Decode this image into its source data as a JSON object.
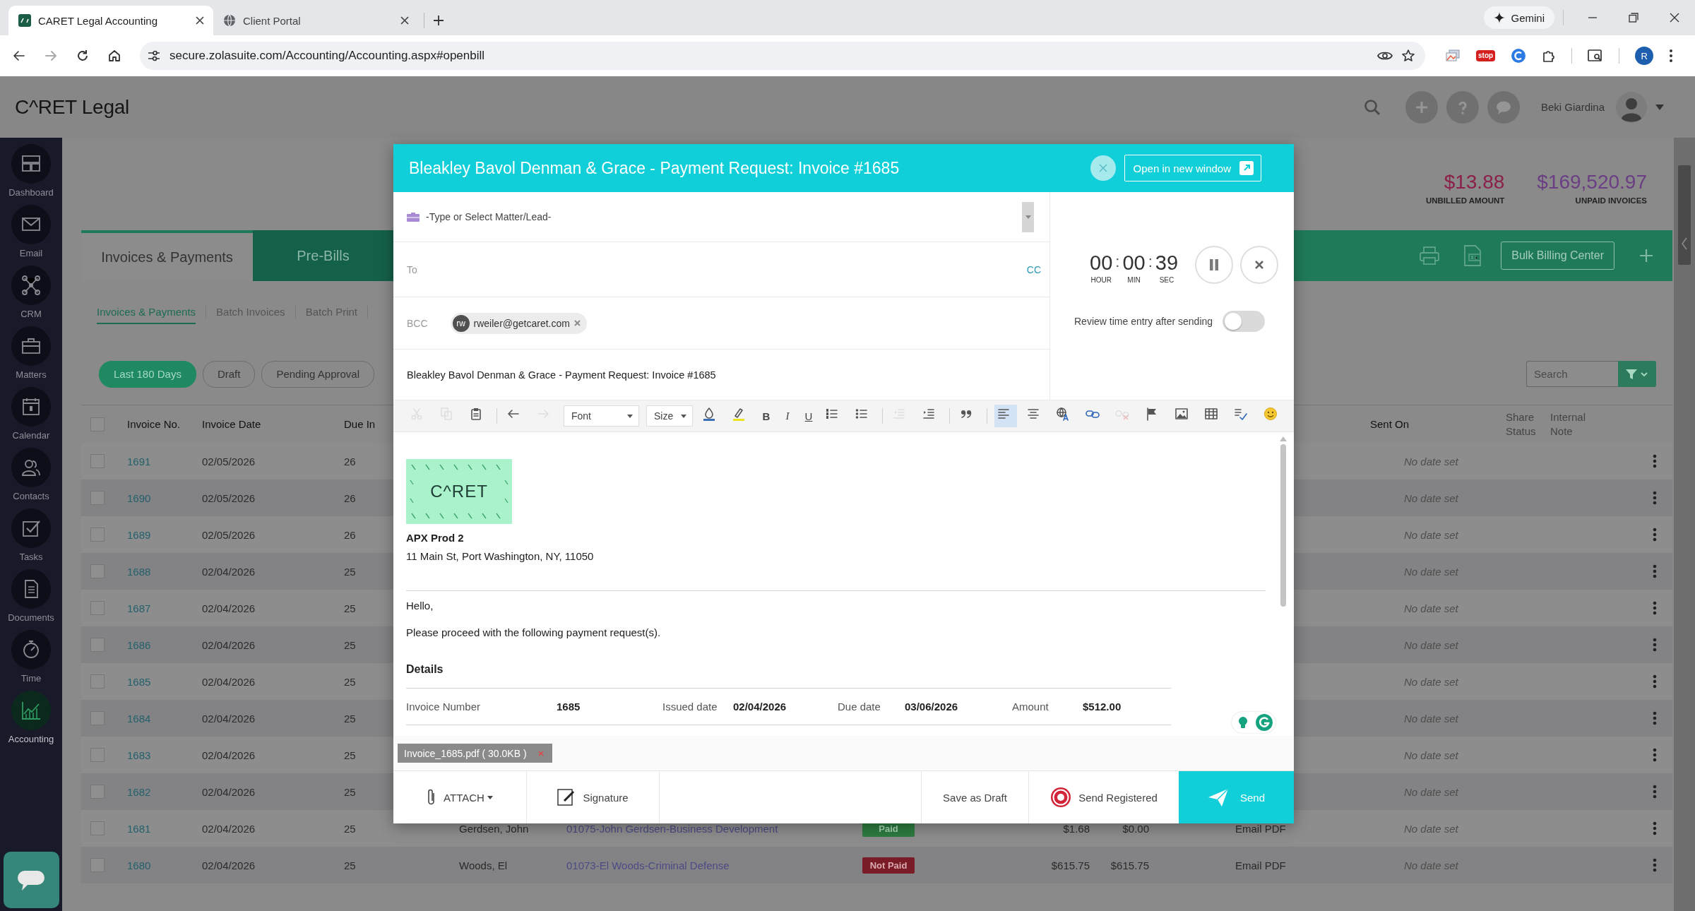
{
  "browser": {
    "tabs": [
      {
        "title": "CARET Legal Accounting",
        "selected": true
      },
      {
        "title": "Client Portal",
        "selected": false
      }
    ],
    "address": "secure.zolasuite.com/Accounting/Accounting.aspx#openbill",
    "gemini": "Gemini",
    "extension_label": "stop",
    "profile": "R"
  },
  "header": {
    "logo": "C^RET Legal",
    "user": "Beki Giardina"
  },
  "sidebar": {
    "items": [
      {
        "label": "Dashboard",
        "selected": false
      },
      {
        "label": "Email",
        "selected": false
      },
      {
        "label": "CRM",
        "selected": false
      },
      {
        "label": "Matters",
        "selected": false
      },
      {
        "label": "Calendar",
        "selected": false
      },
      {
        "label": "Contacts",
        "selected": false
      },
      {
        "label": "Tasks",
        "selected": false
      },
      {
        "label": "Documents",
        "selected": false
      },
      {
        "label": "Time",
        "selected": false
      },
      {
        "label": "Accounting",
        "selected": true
      }
    ]
  },
  "summary": [
    {
      "amount": "$13.88",
      "label": "UNBILLED AMOUNT",
      "color": "#8c1e4a"
    },
    {
      "amount": "$169,520.97",
      "label": "UNPAID INVOICES",
      "color": "#6b3d84"
    }
  ],
  "main_tabs": [
    {
      "label": "Invoices & Payments",
      "selected": true
    },
    {
      "label": "Pre-Bills",
      "selected": false
    }
  ],
  "bulk_button": "Bulk Billing Center",
  "sub_tabs": [
    {
      "label": "Invoices & Payments",
      "selected": true
    },
    {
      "label": "Batch Invoices",
      "selected": false
    },
    {
      "label": "Batch Print",
      "selected": false
    }
  ],
  "filters": [
    {
      "label": "Last 180 Days",
      "selected": true
    },
    {
      "label": "Draft",
      "selected": false
    },
    {
      "label": "Pending Approval",
      "selected": false
    }
  ],
  "search": {
    "placeholder": "Search"
  },
  "table": {
    "select_all": {
      "checked": false
    },
    "columns": [
      "Invoice No.",
      "Invoice Date",
      "Due In",
      "Sent On",
      "Share Status",
      "Internal Note"
    ],
    "rows": [
      {
        "checked": false,
        "invoice": "1691",
        "date": "02/05/2026",
        "due_in": "26",
        "sent_on": "No date set"
      },
      {
        "checked": false,
        "invoice": "1690",
        "date": "02/05/2026",
        "due_in": "26",
        "sent_on": "No date set"
      },
      {
        "checked": false,
        "invoice": "1689",
        "date": "02/05/2026",
        "due_in": "26",
        "sent_on": "No date set"
      },
      {
        "checked": false,
        "invoice": "1688",
        "date": "02/04/2026",
        "due_in": "25",
        "sent_on": "No date set"
      },
      {
        "checked": false,
        "invoice": "1687",
        "date": "02/04/2026",
        "due_in": "25",
        "sent_on": "No date set"
      },
      {
        "checked": false,
        "invoice": "1686",
        "date": "02/04/2026",
        "due_in": "25",
        "sent_on": "No date set"
      },
      {
        "checked": false,
        "invoice": "1685",
        "date": "02/04/2026",
        "due_in": "25",
        "sent_on": "No date set"
      },
      {
        "checked": false,
        "invoice": "1684",
        "date": "02/04/2026",
        "due_in": "25",
        "sent_on": "No date set"
      },
      {
        "checked": false,
        "invoice": "1683",
        "date": "02/04/2026",
        "due_in": "25",
        "sent_on": "No date set"
      },
      {
        "checked": false,
        "invoice": "1682",
        "date": "02/04/2026",
        "due_in": "25",
        "sent_on": "No date set"
      },
      {
        "checked": false,
        "invoice": "1681",
        "date": "02/04/2026",
        "due_in": "25",
        "client": "Gerdsen, John",
        "matter": "01075-John Gerdsen-Business Development",
        "status": {
          "label": "Paid",
          "kind": "paid"
        },
        "total": "$1.68",
        "balance": "$0.00",
        "sent_via": "Email PDF",
        "sent_on": "No date set"
      },
      {
        "checked": false,
        "invoice": "1680",
        "date": "02/04/2026",
        "due_in": "25",
        "client": "Woods, El",
        "matter": "01073-El Woods-Criminal Defense",
        "status": {
          "label": "Not Paid",
          "kind": "not_paid"
        },
        "total": "$615.75",
        "balance": "$615.75",
        "sent_via": "Email PDF",
        "sent_on": "No date set"
      }
    ]
  },
  "modal": {
    "title": "Bleakley Bavol Denman & Grace - Payment Request: Invoice #1685",
    "open_new": "Open in new window",
    "matter_placeholder": "-Type or Select Matter/Lead-",
    "to_label": "To",
    "cc": "CC",
    "bcc_label": "BCC",
    "bcc_chips": [
      {
        "initials": "rw",
        "email": "rweiler@getcaret.com"
      }
    ],
    "subject": "Bleakley Bavol Denman & Grace - Payment Request: Invoice #1685",
    "timer": {
      "units": [
        {
          "value": "00",
          "label": "HOUR"
        },
        {
          "value": "00",
          "label": "MIN"
        },
        {
          "value": "39",
          "label": "SEC"
        }
      ],
      "separator": ":"
    },
    "review_toggle": {
      "label": "Review time entry after sending",
      "on": false
    },
    "toolbar": [
      {
        "kind": "cut",
        "disabled": true
      },
      {
        "kind": "copy",
        "disabled": true
      },
      {
        "kind": "paste",
        "disabled": false
      },
      {
        "kind": "separator"
      },
      {
        "kind": "undo",
        "disabled": false
      },
      {
        "kind": "redo",
        "disabled": true
      },
      {
        "kind": "dropdown",
        "label": "Font"
      },
      {
        "kind": "dropdown",
        "label": "Size"
      },
      {
        "kind": "text_color",
        "disabled": false
      },
      {
        "kind": "highlight",
        "disabled": false
      },
      {
        "kind": "bold",
        "label": "B",
        "disabled": false
      },
      {
        "kind": "italic",
        "label": "I",
        "disabled": false
      },
      {
        "kind": "underline",
        "label": "U",
        "disabled": false
      },
      {
        "kind": "numbered_list",
        "disabled": false
      },
      {
        "kind": "bullet_list",
        "disabled": false
      },
      {
        "kind": "separator"
      },
      {
        "kind": "outdent",
        "disabled": true
      },
      {
        "kind": "indent",
        "disabled": false
      },
      {
        "kind": "separator"
      },
      {
        "kind": "blockquote",
        "disabled": false
      },
      {
        "kind": "separator"
      },
      {
        "kind": "align_left",
        "selected": true
      },
      {
        "kind": "align_center",
        "selected": false
      },
      {
        "kind": "language",
        "disabled": false
      },
      {
        "kind": "link",
        "disabled": false
      },
      {
        "kind": "unlink",
        "disabled": true
      },
      {
        "kind": "flag",
        "disabled": false
      },
      {
        "kind": "image",
        "disabled": false
      },
      {
        "kind": "table",
        "disabled": false
      },
      {
        "kind": "spellcheck",
        "disabled": false
      },
      {
        "kind": "emoji",
        "disabled": false
      }
    ],
    "body": {
      "logo": "C^RET",
      "company": "APX Prod 2",
      "address": "11 Main St, Port Washington, NY, 11050",
      "greeting": "Hello,",
      "message": "Please proceed with the following payment request(s).",
      "details_heading": "Details",
      "details": [
        {
          "label": "Invoice Number",
          "value": "1685"
        },
        {
          "label": "Issued date",
          "value": "02/04/2026"
        },
        {
          "label": "Due date",
          "value": "03/06/2026"
        },
        {
          "label": "Amount",
          "value": "$512.00"
        }
      ]
    },
    "attachment": "Invoice_1685.pdf ( 30.0KB )",
    "actions": {
      "attach": "ATTACH",
      "signature": "Signature",
      "save_draft": "Save as Draft",
      "send_registered": "Send Registered",
      "send": "Send"
    }
  }
}
